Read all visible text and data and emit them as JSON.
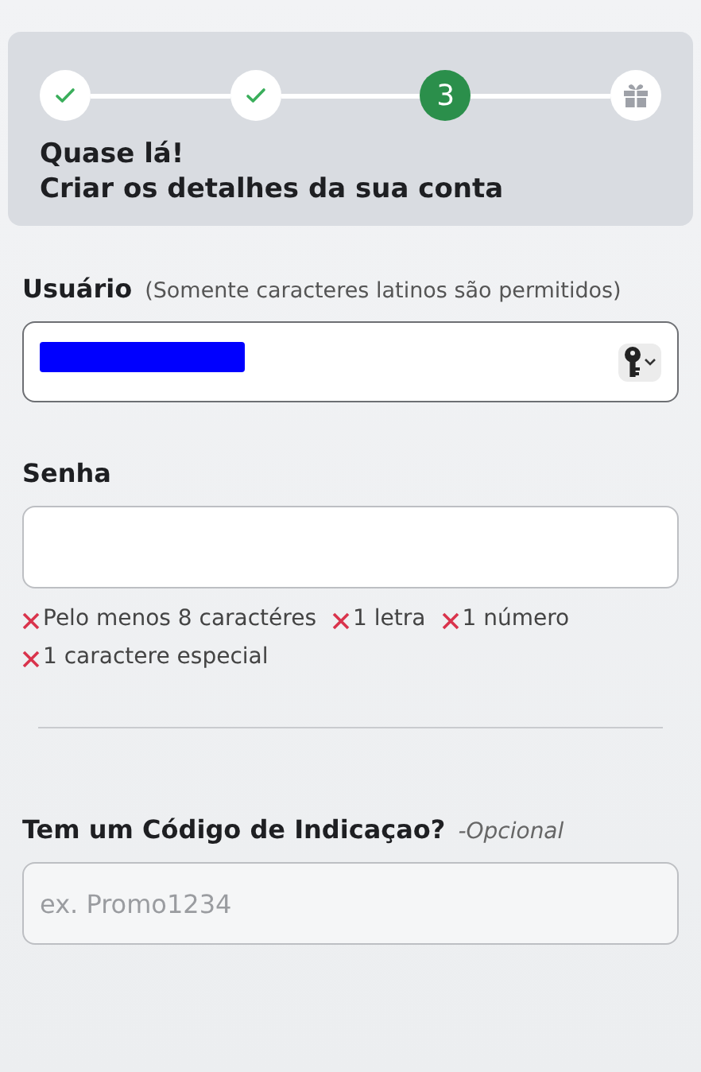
{
  "progress": {
    "steps": [
      {
        "completed": true,
        "current": false
      },
      {
        "completed": true,
        "current": false
      },
      {
        "completed": false,
        "current": true,
        "label": "3"
      }
    ],
    "reward_step": {
      "reached": false
    },
    "title": "Quase lá!",
    "subtitle": "Criar os detalhes da sua conta"
  },
  "username": {
    "label": "Usuário",
    "hint": "(Somente caracteres latinos são permitidos)",
    "redacted": true
  },
  "password": {
    "label": "Senha",
    "requirements": [
      {
        "text": "Pelo menos 8 caractéres",
        "met": false
      },
      {
        "text": "1 letra",
        "met": false
      },
      {
        "text": "1 número",
        "met": false
      },
      {
        "text": "1 caractere especial",
        "met": false
      }
    ]
  },
  "referral": {
    "label": "Tem um Código de Indicaçao?",
    "optional": "-Opcional",
    "placeholder": "ex. Promo1234"
  }
}
